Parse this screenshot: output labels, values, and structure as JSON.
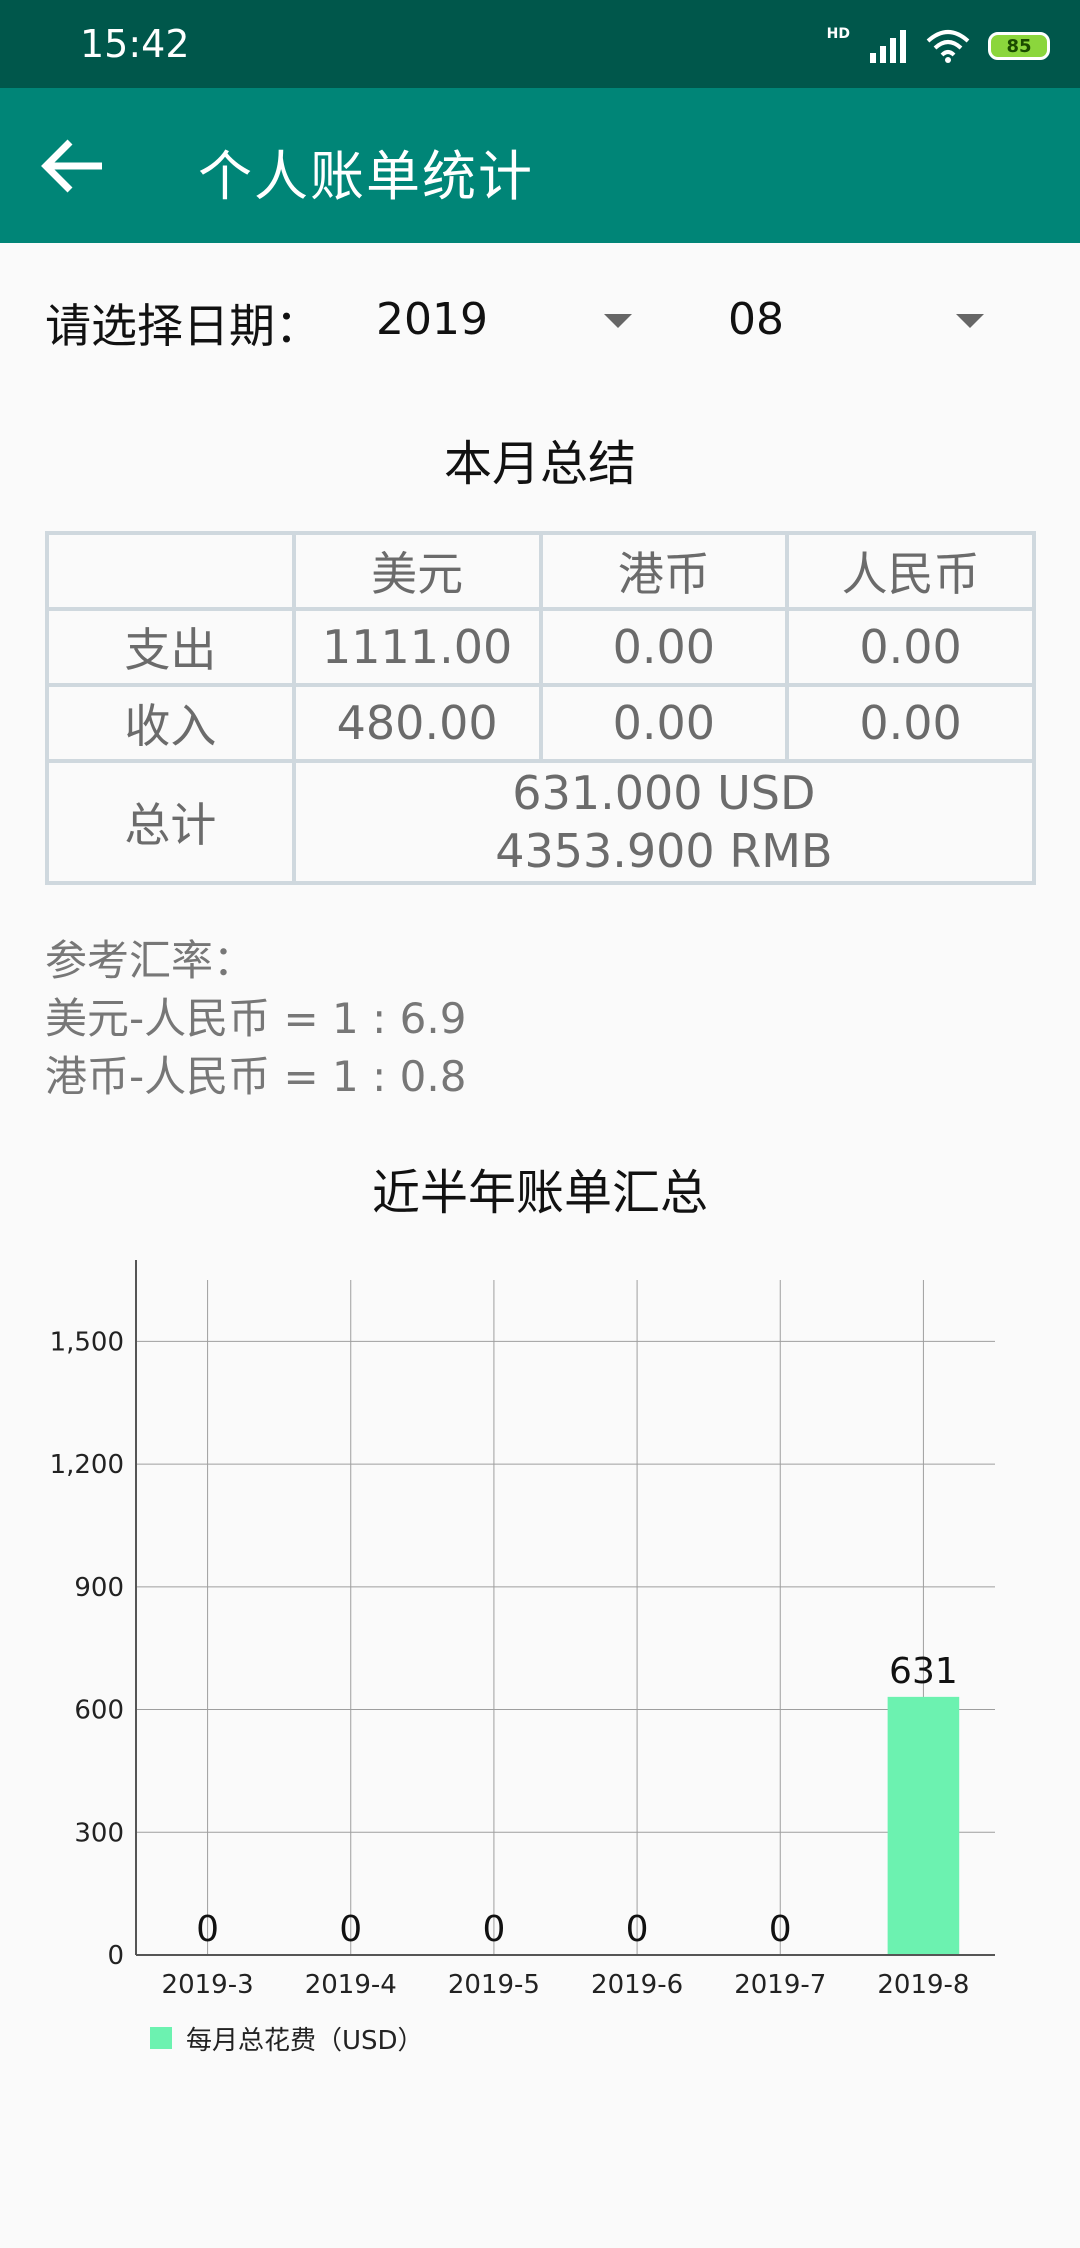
{
  "status": {
    "time": "15:42",
    "battery": "85",
    "network_badge": "HD"
  },
  "app_bar": {
    "title": "个人账单统计"
  },
  "date_picker": {
    "label": "请选择日期：",
    "year": "2019",
    "month": "08"
  },
  "summary": {
    "title": "本月总结",
    "headers": [
      "",
      "美元",
      "港币",
      "人民币"
    ],
    "rows": [
      {
        "label": "支出",
        "values": [
          "1111.00",
          "0.00",
          "0.00"
        ]
      },
      {
        "label": "收入",
        "values": [
          "480.00",
          "0.00",
          "0.00"
        ]
      }
    ],
    "total": {
      "label": "总计",
      "usd": "631.000 USD",
      "rmb": "4353.900 RMB"
    }
  },
  "rates": {
    "title": "参考汇率：",
    "usd_rmb": "美元-人民币 = 1 : 6.9",
    "hkd_rmb": "港币-人民币 = 1 : 0.8"
  },
  "chart_title": "近半年账单汇总",
  "colors": {
    "primary": "#008577",
    "primary_dark": "#00574b",
    "bar": "#6cf2b0"
  },
  "chart_data": {
    "type": "bar",
    "categories": [
      "2019-3",
      "2019-4",
      "2019-5",
      "2019-6",
      "2019-7",
      "2019-8"
    ],
    "series": [
      {
        "name": "每月总花费（USD）",
        "values": [
          0,
          0,
          0,
          0,
          0,
          631
        ]
      }
    ],
    "data_labels": [
      "0",
      "0",
      "0",
      "0",
      "0",
      "631"
    ],
    "ylim": [
      0,
      1650
    ],
    "yticks": [
      0,
      300,
      600,
      900,
      1200,
      1500
    ],
    "ytick_labels": [
      "0",
      "300",
      "600",
      "900",
      "1,200",
      "1,500"
    ],
    "grid": true,
    "legend": "bottom-left"
  }
}
